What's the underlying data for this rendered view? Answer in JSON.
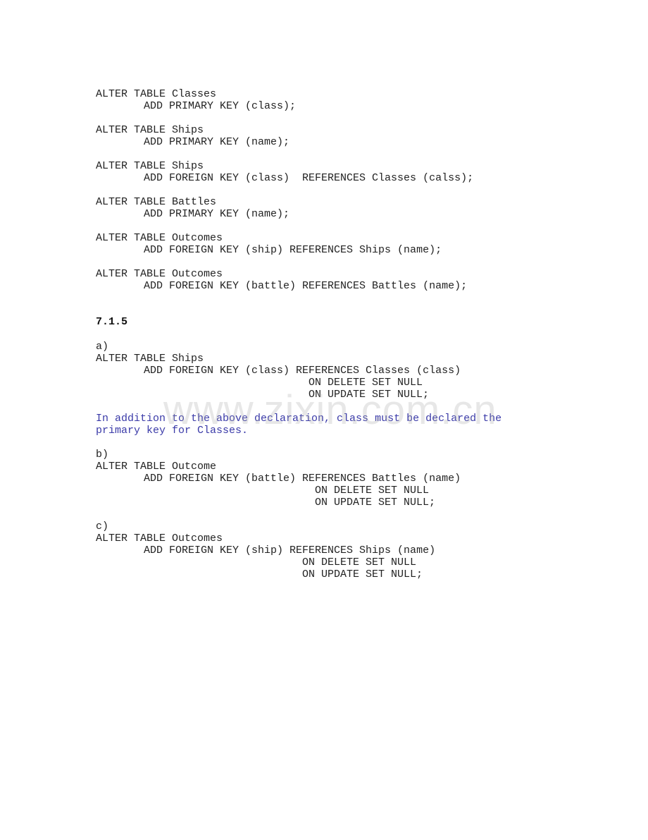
{
  "document": {
    "blocks_part1": [
      {
        "head": "ALTER TABLE Classes",
        "body": "ADD PRIMARY KEY (class);"
      },
      {
        "head": "ALTER TABLE Ships",
        "body": "ADD PRIMARY KEY (name);"
      },
      {
        "head": "ALTER TABLE Ships",
        "body": "ADD FOREIGN KEY (class)  REFERENCES Classes (calss);"
      },
      {
        "head": "ALTER TABLE Battles",
        "body": "ADD PRIMARY KEY (name);"
      },
      {
        "head": "ALTER TABLE Outcomes",
        "body": "ADD FOREIGN KEY (ship) REFERENCES Ships (name);"
      },
      {
        "head": "ALTER TABLE Outcomes",
        "body": "ADD FOREIGN KEY (battle) REFERENCES Battles (name);"
      }
    ],
    "section_heading": "7.1.5",
    "part_a": {
      "label": "a)",
      "head": "ALTER TABLE Ships",
      "body": "ADD FOREIGN KEY (class) REFERENCES Classes (class)",
      "on_delete": "ON DELETE SET NULL",
      "on_update": "ON UPDATE SET NULL;",
      "note_line1": "In addition to the above declaration, class must be declared the",
      "note_line2": "primary key for Classes."
    },
    "part_b": {
      "label": "b)",
      "head": "ALTER TABLE Outcome",
      "body": "ADD FOREIGN KEY (battle) REFERENCES Battles (name)",
      "on_delete": "ON DELETE SET NULL",
      "on_update": "ON UPDATE SET NULL;"
    },
    "part_c": {
      "label": "c)",
      "head": "ALTER TABLE Outcomes",
      "body": "ADD FOREIGN KEY (ship) REFERENCES Ships (name)",
      "on_delete": "ON DELETE SET NULL",
      "on_update": "ON UPDATE SET NULL;"
    },
    "watermark": "www.zixin.com.cn"
  },
  "colors": {
    "note_text": "#3a3aa8",
    "body_text": "#222222"
  }
}
